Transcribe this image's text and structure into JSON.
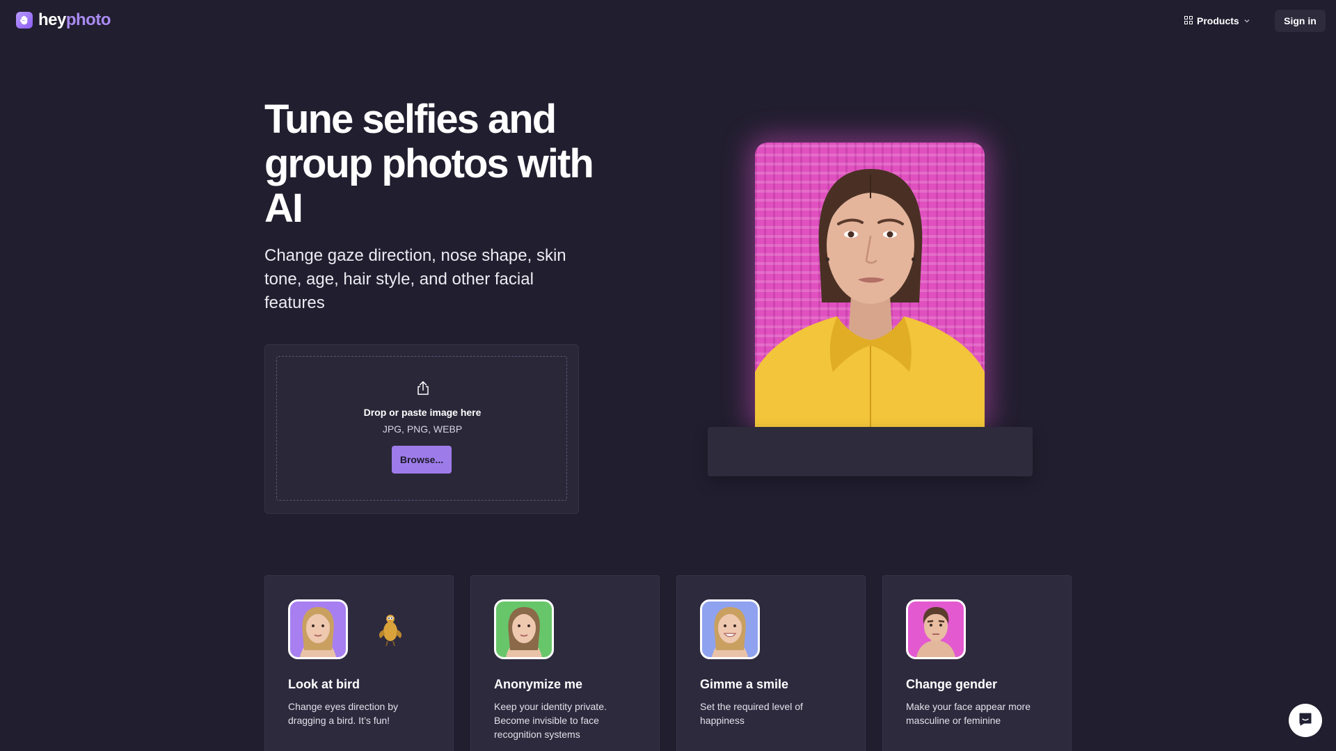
{
  "brand": {
    "name_part1": "hey",
    "name_part2": "photo",
    "accent": "#a98bf2"
  },
  "nav": {
    "products_label": "Products",
    "signin_label": "Sign in"
  },
  "hero": {
    "title": "Tune selfies and group photos with AI",
    "subtitle": "Change gaze direction, nose shape, skin tone, age, hair style, and other facial features"
  },
  "upload": {
    "icon": "upload-icon",
    "drop_text": "Drop or paste image here",
    "formats": "JPG, PNG, WEBP",
    "browse_label": "Browse..."
  },
  "preview": {
    "background_color": "#e051bf",
    "jacket_color": "#f2c53a"
  },
  "features": [
    {
      "title": "Look at bird",
      "desc": "Change eyes direction by dragging a bird. It’s fun!",
      "thumb_bg": "#a77ff0"
    },
    {
      "title": "Anonymize me",
      "desc": "Keep your identity private. Become invisible to face recognition systems",
      "thumb_bg": "#68c66a"
    },
    {
      "title": "Gimme a smile",
      "desc": "Set the required level of happiness",
      "thumb_bg": "#8fa2ef"
    },
    {
      "title": "Change gender",
      "desc": "Make your face appear more masculine or feminine",
      "thumb_bg": "#e35ad0"
    }
  ],
  "chat": {
    "icon": "chat-icon"
  }
}
